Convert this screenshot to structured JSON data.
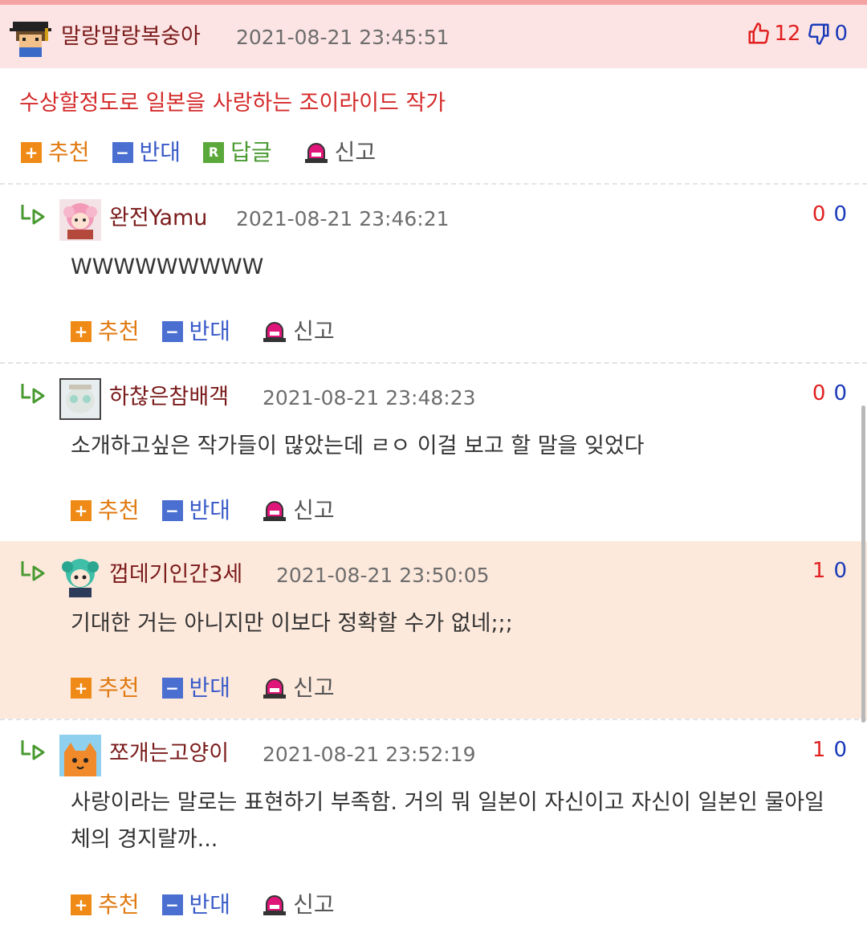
{
  "main_comment": {
    "nickname": "말랑말랑복숭아",
    "date": "2021-08-21 23:45:51",
    "likes": "12",
    "dislikes": "0",
    "body": "수상할정도로 일본을 사랑하는 조이라이드 작가",
    "avatar_icon": "pixel-character-icon"
  },
  "actions": {
    "recommend": "추천",
    "oppose": "반대",
    "reply": "답글",
    "report": "신고",
    "reply_icon_letter": "R"
  },
  "replies": [
    {
      "nickname": "완전Yamu",
      "date": "2021-08-21 23:46:21",
      "up": "0",
      "down": "0",
      "body": "WWWWWWWWW",
      "highlighted": false
    },
    {
      "nickname": "하찮은참배객",
      "date": "2021-08-21 23:48:23",
      "up": "0",
      "down": "0",
      "body": "소개하고싶은 작가들이 많았는데 ㄹㅇ 이걸 보고 할 말을 잊었다",
      "highlighted": false
    },
    {
      "nickname": "껍데기인간3세",
      "date": "2021-08-21 23:50:05",
      "up": "1",
      "down": "0",
      "body": "기대한 거는 아니지만 이보다 정확할 수가 없네;;;",
      "highlighted": true
    },
    {
      "nickname": "쪼개는고양이",
      "date": "2021-08-21 23:52:19",
      "up": "1",
      "down": "0",
      "body": "사랑이라는 말로는 표현하기 부족함. 거의 뭐 일본이 자신이고 자신이 일본인 물아일체의 경지랄까...",
      "highlighted": false
    }
  ],
  "colors": {
    "header_bg": "#fde4e4",
    "highlight_bg": "#fde9dc",
    "nickname": "#7a1a1a",
    "main_body_text": "#d42a2a",
    "recommend": "#f08a16",
    "oppose": "#4a6fd0",
    "reply": "#5aa83a",
    "vote_up": "#e02020",
    "vote_down": "#1a3ab8"
  }
}
